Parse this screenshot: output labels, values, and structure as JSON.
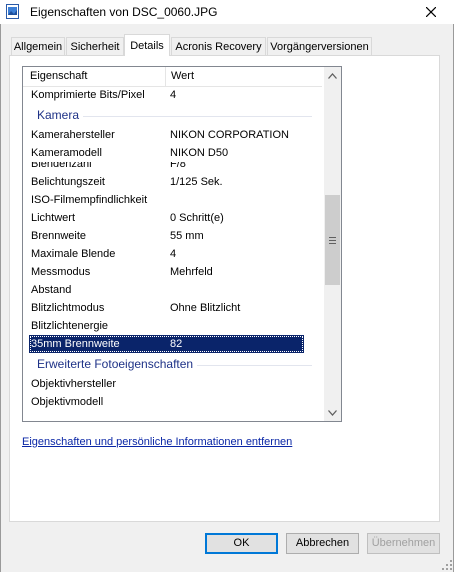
{
  "window": {
    "title": "Eigenschaften von DSC_0060.JPG",
    "close_glyph": "✕"
  },
  "tabs": [
    {
      "label": "Allgemein",
      "active": false
    },
    {
      "label": "Sicherheit",
      "active": false
    },
    {
      "label": "Details",
      "active": true
    },
    {
      "label": "Acronis Recovery",
      "active": false
    },
    {
      "label": "Vorgängerversionen",
      "active": false
    }
  ],
  "columns": {
    "property": "Eigenschaft",
    "value": "Wert"
  },
  "rows": {
    "compressed_bits": {
      "prop": "Komprimierte Bits/Pixel",
      "val": "4"
    },
    "group_camera": "Kamera",
    "manufacturer": {
      "prop": "Kamerahersteller",
      "val": "NIKON CORPORATION"
    },
    "model": {
      "prop": "Kameramodell",
      "val": "NIKON D50"
    },
    "fstop": {
      "prop": "Blendenzahl",
      "val": "F/8"
    },
    "exposure": {
      "prop": "Belichtungszeit",
      "val": "1/125 Sek."
    },
    "iso": {
      "prop": "ISO-Filmempfindlichkeit",
      "val": ""
    },
    "exposure_bias": {
      "prop": "Lichtwert",
      "val": "0 Schritt(e)"
    },
    "focal_length": {
      "prop": "Brennweite",
      "val": "55 mm"
    },
    "max_aperture": {
      "prop": "Maximale Blende",
      "val": "4"
    },
    "metering": {
      "prop": "Messmodus",
      "val": "Mehrfeld"
    },
    "distance": {
      "prop": "Abstand",
      "val": ""
    },
    "flash_mode": {
      "prop": "Blitzlichtmodus",
      "val": "Ohne Blitzlicht"
    },
    "flash_energy": {
      "prop": "Blitzlichtenergie",
      "val": ""
    },
    "focal_35mm": {
      "prop": "35mm Brennweite",
      "val": "82"
    },
    "group_advanced": "Erweiterte Fotoeigenschaften",
    "lens_maker": {
      "prop": "Objektivhersteller",
      "val": ""
    },
    "lens_model": {
      "prop": "Objektivmodell",
      "val": ""
    }
  },
  "selected_row": "focal_35mm",
  "link_text": "Eigenschaften und persönliche Informationen entfernen",
  "buttons": {
    "ok": "OK",
    "cancel": "Abbrechen",
    "apply": "Übernehmen"
  },
  "colors": {
    "selection": "#0a246a",
    "group_header": "#1e3287",
    "link": "#0a26a6",
    "default_button_border": "#0078d7"
  }
}
